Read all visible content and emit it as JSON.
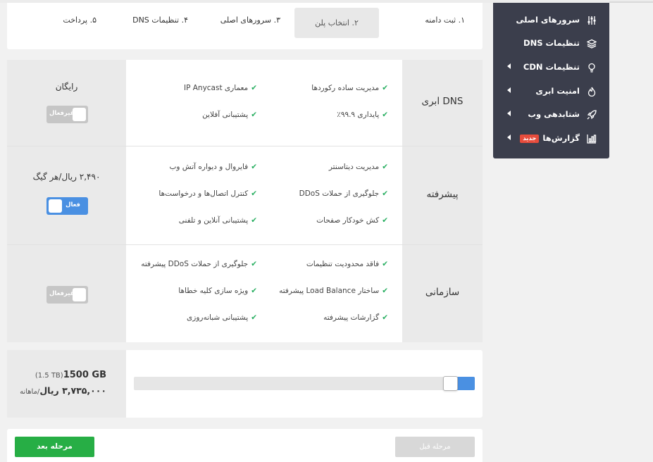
{
  "steps": [
    {
      "label": "۱. ثبت دامنه",
      "active": false
    },
    {
      "label": "۲. انتخاب پلن",
      "active": true
    },
    {
      "label": "۳. سرورهای اصلی",
      "active": false
    },
    {
      "label": "۴. تنظیمات DNS",
      "active": false
    },
    {
      "label": "۵. پرداخت",
      "active": false
    }
  ],
  "sidebar": {
    "items": [
      {
        "label": "سرورهای اصلی",
        "icon": "sliders-icon",
        "has_arrow": false
      },
      {
        "label": "تنظیمات DNS",
        "icon": "layers-icon",
        "has_arrow": false
      },
      {
        "label": "تنظیمات CDN",
        "icon": "lightbulb-icon",
        "has_arrow": true
      },
      {
        "label": "امنیت ابری",
        "icon": "flame-icon",
        "has_arrow": true
      },
      {
        "label": "شتابدهی وب",
        "icon": "rocket-icon",
        "has_arrow": true
      },
      {
        "label": "گزارش‌ها",
        "icon": "bar-chart-icon",
        "has_arrow": true,
        "badge": "جدید"
      }
    ]
  },
  "plans": [
    {
      "name": "DNS ابری",
      "features_right": [
        "مدیریت ساده رکوردها",
        "پایداری ۹۹.۹٪"
      ],
      "features_left": [
        "معماری IP Anycast",
        "پشتیبانی آفلاین"
      ],
      "price": "رایگان",
      "toggle_label": "غیرفعال",
      "toggle_on": false
    },
    {
      "name": "پیشرفته",
      "features_right": [
        "مدیریت دیتاسنتر",
        "جلوگیری از حملات DDoS",
        "کش خودکار صفحات"
      ],
      "features_left": [
        "فایروال و دیواره آتش وب",
        "کنترل اتصال‌ها و درخواست‌ها",
        "پشتیبانی آنلاین و تلفنی"
      ],
      "price": "۲,۴۹۰ ریال/هر گیگ",
      "toggle_label": "فعال",
      "toggle_on": true
    },
    {
      "name": "سازمانی",
      "features_right": [
        "فاقد محدودیت تنظیمات",
        "ساختار Load Balance پیشرفته",
        "گزارشات پیشرفته"
      ],
      "features_left": [
        "جلوگیری از حملات DDoS پیشرفته",
        "ویژه سازی کلیه خطاها",
        "پشتیبانی شبانه‌روزی"
      ],
      "price": "",
      "toggle_label": "غیرفعال",
      "toggle_on": false
    }
  ],
  "bandwidth": {
    "size": "1500 GB",
    "size_alt": "(1.5 TB)",
    "cost_value": "۳,۷۳۵,۰۰۰ ریال",
    "cost_unit": "/ماهانه",
    "slider_level": 0.07
  },
  "footer": {
    "next_label": "مرحله بعد",
    "prev_label": "مرحله قبل"
  },
  "colors": {
    "accent": "#4a90e2",
    "success": "#27ae45",
    "sidebar_bg": "#3b3e4c",
    "badge": "#e74c3c"
  }
}
